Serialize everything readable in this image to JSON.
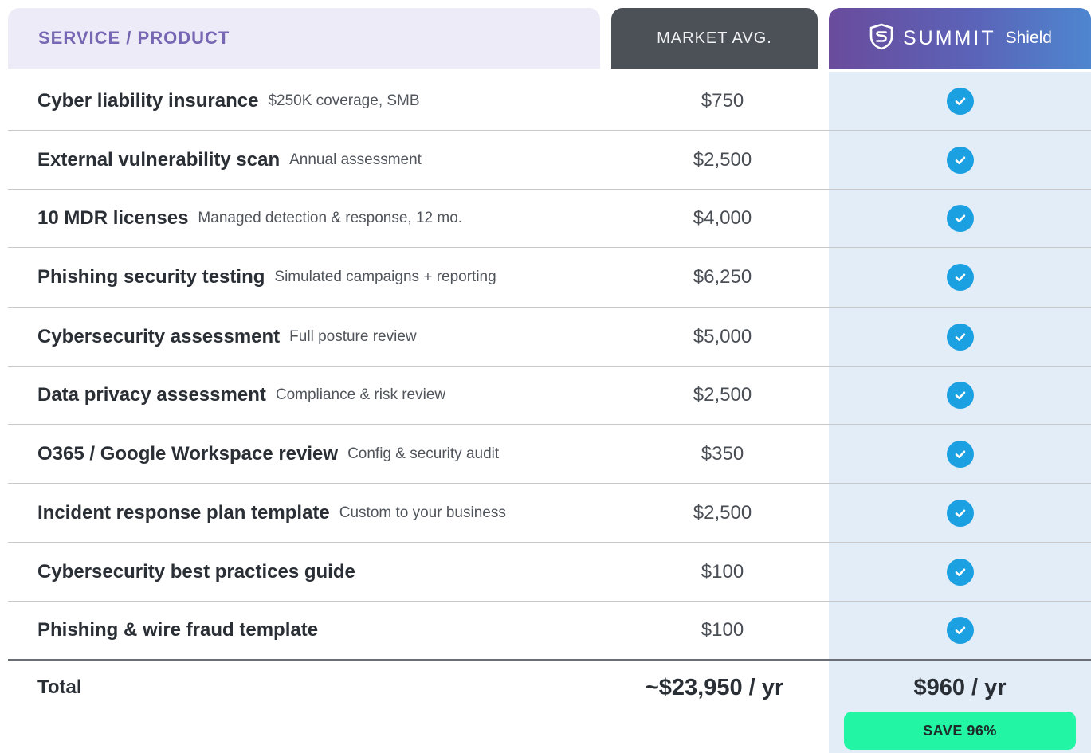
{
  "header": {
    "service_label": "SERVICE / PRODUCT",
    "market_label": "MARKET AVG.",
    "brand_main": "SUMMIT",
    "brand_sub": "Shield"
  },
  "rows": [
    {
      "name": "Cyber liability insurance",
      "desc": "$250K coverage, SMB",
      "price": "$750",
      "included": true
    },
    {
      "name": "External vulnerability scan",
      "desc": "Annual assessment",
      "price": "$2,500",
      "included": true
    },
    {
      "name": "10 MDR licenses",
      "desc": "Managed detection & response, 12 mo.",
      "price": "$4,000",
      "included": true
    },
    {
      "name": "Phishing security testing",
      "desc": "Simulated campaigns + reporting",
      "price": "$6,250",
      "included": true
    },
    {
      "name": "Cybersecurity assessment",
      "desc": "Full posture review",
      "price": "$5,000",
      "included": true
    },
    {
      "name": "Data privacy assessment",
      "desc": "Compliance & risk review",
      "price": "$2,500",
      "included": true
    },
    {
      "name": "O365 / Google Workspace review",
      "desc": "Config & security audit",
      "price": "$350",
      "included": true
    },
    {
      "name": "Incident response plan template",
      "desc": "Custom to your business",
      "price": "$2,500",
      "included": true
    },
    {
      "name": "Cybersecurity best practices guide",
      "desc": "",
      "price": "$100",
      "included": true
    },
    {
      "name": "Phishing & wire fraud template",
      "desc": "",
      "price": "$100",
      "included": true
    }
  ],
  "total": {
    "label": "Total",
    "market": "~$23,950 / yr",
    "shield": "$960 / yr",
    "savings": "SAVE 96%"
  },
  "colors": {
    "check": "#1ba0e2",
    "shield_column": "#e3edf8",
    "market_header": "#4c5057",
    "service_header_text": "#7766b4",
    "savings_badge": "#22f5a3"
  },
  "icons": {
    "brand": "shield-s-logo-icon",
    "included": "check-circle-icon"
  }
}
